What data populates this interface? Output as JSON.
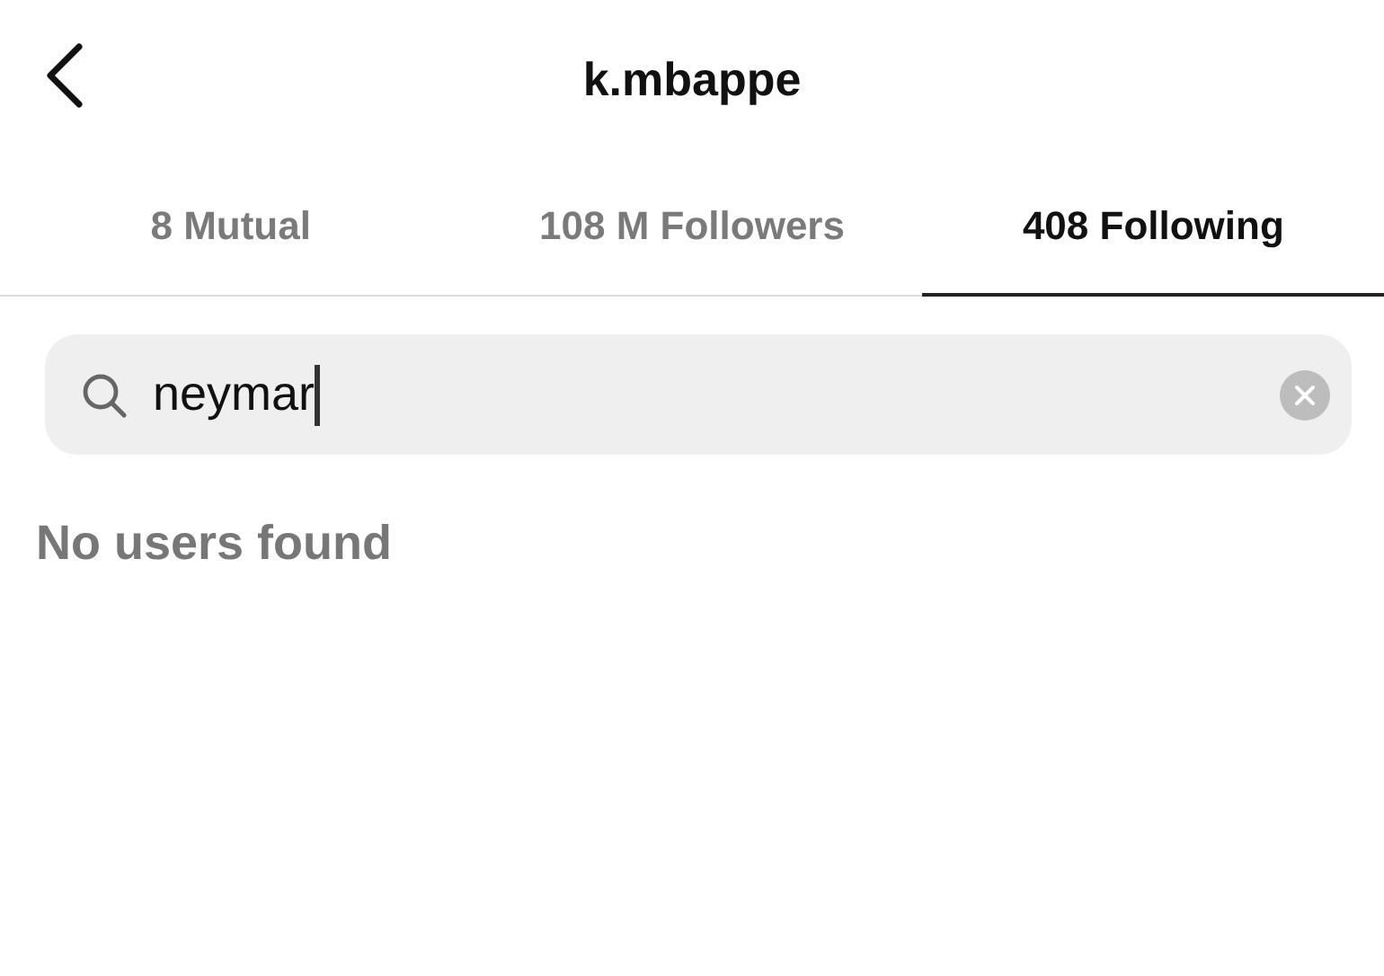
{
  "header": {
    "title": "k.mbappe"
  },
  "tabs": [
    {
      "label": "8 Mutual",
      "selected": false
    },
    {
      "label": "108 M Followers",
      "selected": false
    },
    {
      "label": "408 Following",
      "selected": true
    }
  ],
  "search": {
    "value": "neymar"
  },
  "empty_message": "No users found"
}
